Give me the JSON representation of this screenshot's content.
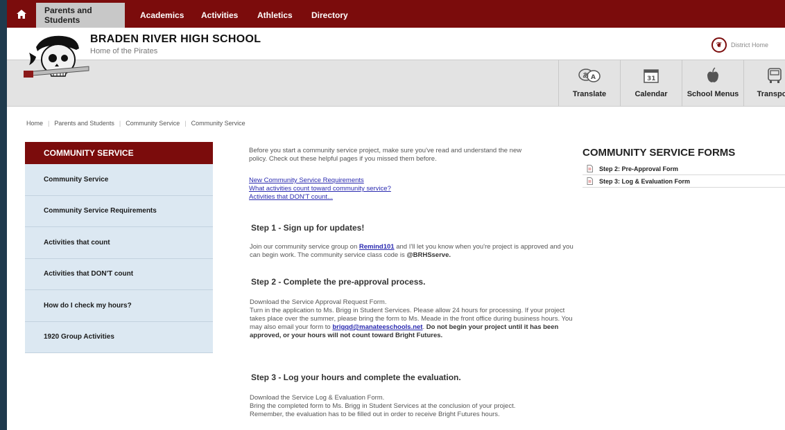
{
  "nav": {
    "items": [
      {
        "label": "Parents and Students",
        "active": true
      },
      {
        "label": "Academics"
      },
      {
        "label": "Activities"
      },
      {
        "label": "Athletics"
      },
      {
        "label": "Directory"
      }
    ]
  },
  "header": {
    "school_name": "BRADEN RIVER HIGH SCHOOL",
    "tagline": "Home of the Pirates",
    "district_link": "District Home"
  },
  "tools": [
    {
      "label": "Translate",
      "icon": "translate-icon"
    },
    {
      "label": "Calendar",
      "icon": "calendar-icon",
      "icon_text": "31"
    },
    {
      "label": "School Menus",
      "icon": "apple-icon"
    },
    {
      "label": "Transport",
      "icon": "bus-icon"
    }
  ],
  "breadcrumb": [
    "Home",
    "Parents and Students",
    "Community Service",
    "Community Service"
  ],
  "sidebar": {
    "title": "COMMUNITY SERVICE",
    "items": [
      {
        "label": "Community Service"
      },
      {
        "label": "Community Service Requirements"
      },
      {
        "label": "Activities that count"
      },
      {
        "label": "Activities that DON'T count"
      },
      {
        "label": "How do I check my hours?"
      },
      {
        "label": "1920 Group Activities"
      }
    ]
  },
  "main": {
    "intro": "Before you start a community service project, make sure you've read and understand the new policy.  Check out these helpful pages if you missed them before.",
    "links": [
      "New Community Service Requirements",
      "What activities count toward community service?",
      "Activities that DON'T count..."
    ],
    "step1": {
      "heading": "Step 1 - Sign up for updates!",
      "text_before": "Join our community service group on ",
      "link": "Remind101",
      "text_after": " and I'll let you know when you're project is approved and you can begin work. The community service class code is ",
      "code": "@BRHSserve."
    },
    "step2": {
      "heading": "Step 2 - Complete the pre-approval process.",
      "line1": "Download the Service Approval Request Form.",
      "line2": "Turn in the application to Ms. Brigg in Student Services.  Please allow 24 hours for processing. If your project takes place over the summer, please bring the form to Ms. Meade in the front office during business hours.  You may also email your form to ",
      "email": "brigqd@manateeschools.net",
      "period": ".  ",
      "warning": "Do not begin your project until it has been approved, or your hours will not  count toward Bright Futures."
    },
    "step3": {
      "heading": "Step 3 - Log your hours and complete the evaluation.",
      "line1": "Download the Service Log & Evaluation Form.",
      "line2": "Bring the completed form to Ms. Brigg in Student Services at the conclusion of your project.",
      "line3": "Remember, the evaluation has to be filled out in order to receive Bright Futures hours."
    }
  },
  "forms": {
    "title": "COMMUNITY SERVICE FORMS",
    "items": [
      {
        "label": "Step 2: Pre-Approval Form"
      },
      {
        "label": "Step 3: Log & Evaluation Form"
      }
    ]
  },
  "colors": {
    "brand": "#7b0c0c",
    "sidebar_bg": "#dce8f2",
    "link": "#2a2ab0"
  }
}
